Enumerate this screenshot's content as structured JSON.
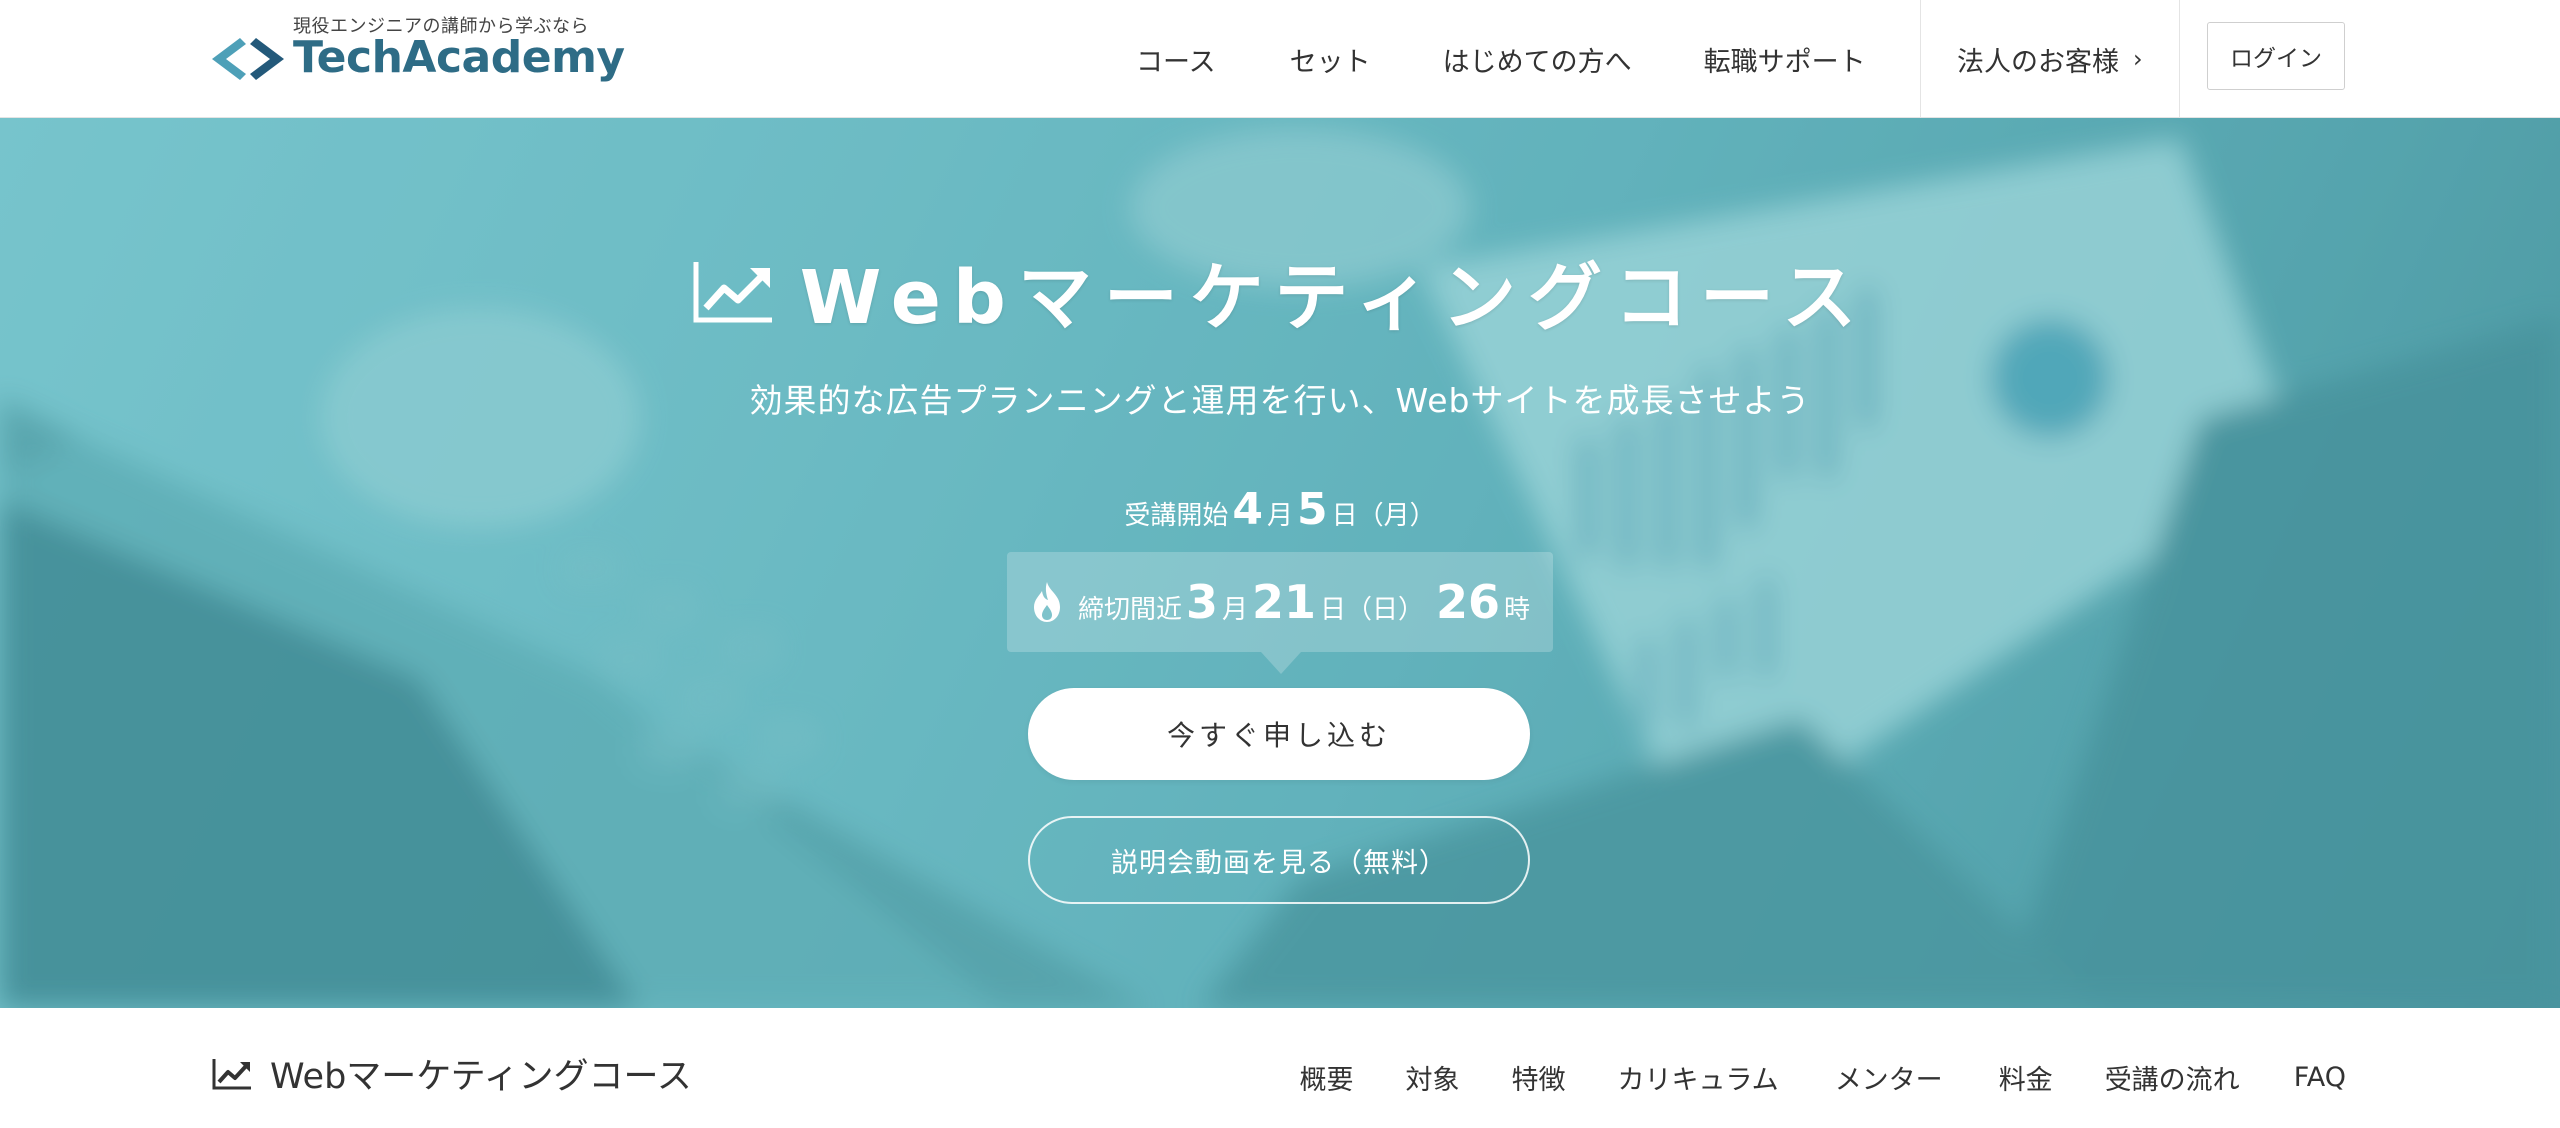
{
  "header": {
    "tagline": "現役エンジニアの講師から学ぶなら",
    "brand": "TechAcademy",
    "nav": [
      "コース",
      "セット",
      "はじめての方へ",
      "転職サポート"
    ],
    "corporate_label": "法人のお客様",
    "login_label": "ログイン"
  },
  "hero": {
    "title": "Webマーケティングコース",
    "subtitle": "効果的な広告プランニングと運用を行い、Webサイトを成長させよう",
    "start": {
      "prefix": "受講開始",
      "month": "4",
      "month_unit": "月",
      "day": "5",
      "day_unit": "日（月）"
    },
    "deadline": {
      "prefix": "締切間近",
      "month": "3",
      "month_unit": "月",
      "day": "21",
      "day_unit": "日（日）",
      "hours": "26",
      "hours_unit": "時"
    },
    "apply_label": "今すぐ申し込む",
    "video_label": "説明会動画を見る（無料）"
  },
  "subnav": {
    "title": "Webマーケティングコース",
    "items": [
      "概要",
      "対象",
      "特徴",
      "カリキュラム",
      "メンター",
      "料金",
      "受講の流れ",
      "FAQ"
    ]
  },
  "colors": {
    "brand": "#2e6c86",
    "hero_tint": "#7ec3cb"
  }
}
